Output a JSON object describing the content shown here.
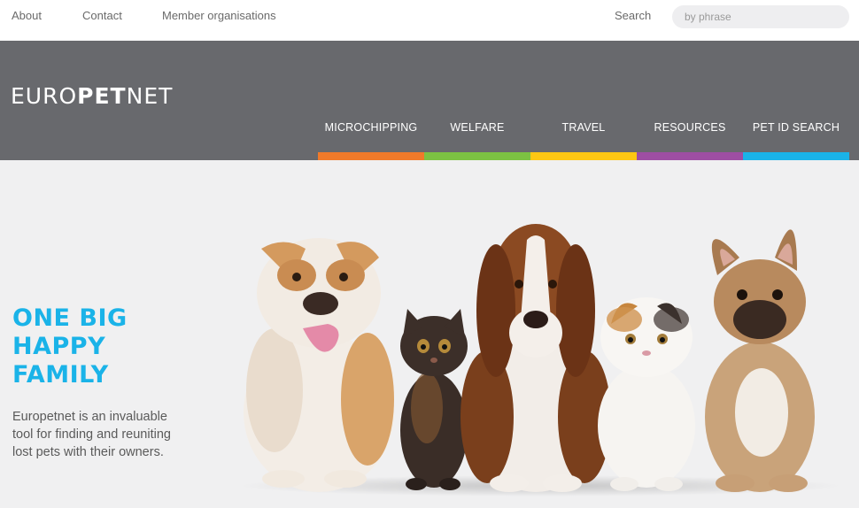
{
  "topbar": {
    "links": [
      "About",
      "Contact",
      "Member organisations"
    ],
    "search_label": "Search",
    "search_placeholder": "by phrase"
  },
  "logo": {
    "part1": "EURO",
    "part2": "PET",
    "part3": "NET"
  },
  "nav": {
    "items": [
      {
        "label": "MICROCHIPPING",
        "color": "#f07a2a"
      },
      {
        "label": "WELFARE",
        "color": "#7cc242"
      },
      {
        "label": "TRAVEL",
        "color": "#fdc713"
      },
      {
        "label": "RESOURCES",
        "color": "#9e4ea3"
      },
      {
        "label": "PET ID SEARCH",
        "color": "#1ab3e8"
      }
    ]
  },
  "hero": {
    "headline": [
      "ONE BIG",
      "HAPPY",
      "FAMILY"
    ],
    "tagline": "Europetnet is an invaluable tool for finding and reuniting lost pets with their owners.",
    "accent_color": "#1ab3e8"
  },
  "image": {
    "icon": "pets-photo"
  }
}
